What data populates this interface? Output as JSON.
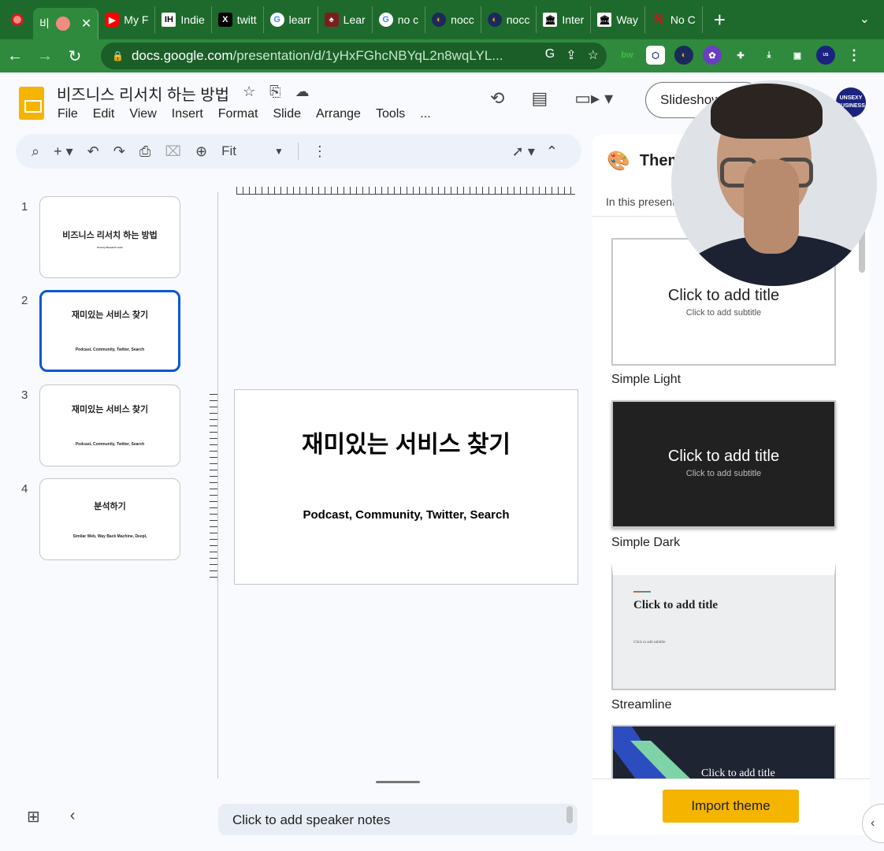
{
  "browser": {
    "tabs": [
      {
        "label": "비",
        "icon": "record-icon",
        "active": true
      },
      {
        "label": "My F",
        "icon": "youtube-icon"
      },
      {
        "label": "Indie",
        "icon": "ih-icon"
      },
      {
        "label": "twitt",
        "icon": "x-icon"
      },
      {
        "label": "learr",
        "icon": "google-icon"
      },
      {
        "label": "Lear",
        "icon": "red-icon"
      },
      {
        "label": "no c",
        "icon": "google-icon"
      },
      {
        "label": "nocc",
        "icon": "nocode-icon"
      },
      {
        "label": "nocc",
        "icon": "nocode-icon"
      },
      {
        "label": "Inter",
        "icon": "archive-icon"
      },
      {
        "label": "Way",
        "icon": "archive-icon"
      },
      {
        "label": "No C",
        "icon": "netflix-icon"
      }
    ],
    "url_host": "docs.google.com",
    "url_path": "/presentation/d/1yHxFGhcNBYqL2n8wqLYL..."
  },
  "doc": {
    "title": "비즈니스 리서치 하는 방법",
    "menu": [
      "File",
      "Edit",
      "View",
      "Insert",
      "Format",
      "Slide",
      "Arrange",
      "Tools",
      "..."
    ],
    "slideshow_label": "Slideshow",
    "avatar_text": "UNSEXY BUSINESS"
  },
  "toolbar": {
    "zoom_label": "Fit"
  },
  "slides": [
    {
      "num": "1",
      "title": "비즈니스 리서치 하는 방법",
      "subtitle": "Unsexy Research tools"
    },
    {
      "num": "2",
      "title": "재미있는 서비스 찾기",
      "subtitle": "Podcast, Community, Twitter, Search"
    },
    {
      "num": "3",
      "title": "재미있는 서비스 찾기",
      "subtitle": "Podcast, Community, Twitter, Search"
    },
    {
      "num": "4",
      "title": "분석하기",
      "subtitle": "Similar Web, Way Back Machine, Deepl,"
    }
  ],
  "current_slide": {
    "title": "재미있는 서비스 찾기",
    "subtitle": "Podcast, Community, Twitter, Search"
  },
  "speaker_notes_placeholder": "Click to add speaker notes",
  "themes_panel": {
    "title": "Themes",
    "section_label": "In this presentation",
    "themes": [
      {
        "name": "Simple Light",
        "card_title": "Click to add title",
        "card_subtitle": "Click to add subtitle"
      },
      {
        "name": "Simple Dark",
        "card_title": "Click to add title",
        "card_subtitle": "Click to add subtitle"
      },
      {
        "name": "Streamline",
        "card_title": "Click to add title",
        "card_subtitle": "Click to add subtitle"
      },
      {
        "name": "",
        "card_title": "Click to add title",
        "card_subtitle": ""
      }
    ],
    "import_label": "Import theme"
  },
  "colors": {
    "browser_accent": "#2f8a3e",
    "slides_yellow": "#f4b400",
    "selection_blue": "#0b57d0",
    "dark_theme": "#212121"
  }
}
